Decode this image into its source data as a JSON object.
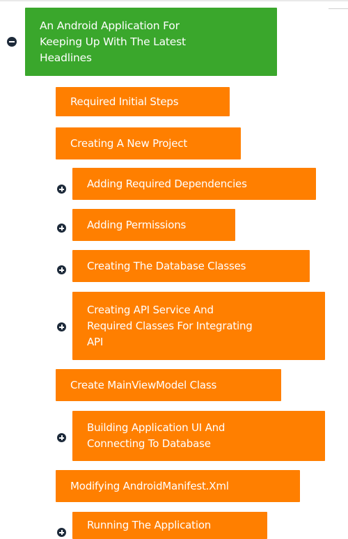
{
  "mindmap": {
    "root": {
      "label": "An Android Application For Keeping Up With The Latest Headlines",
      "lines": [
        "An Android Application For",
        "Keeping Up With The Latest",
        "Headlines"
      ],
      "expanded": true,
      "color": "#3aa72c"
    },
    "node_color": "#ff7f00",
    "toggle_color": "#1d2a3a",
    "children": [
      {
        "lines": [
          "Required Initial Steps"
        ],
        "has_children": false
      },
      {
        "lines": [
          "Creating A New Project"
        ],
        "has_children": false
      },
      {
        "lines": [
          "Adding Required Dependencies"
        ],
        "has_children": true,
        "expanded": false
      },
      {
        "lines": [
          "Adding Permissions"
        ],
        "has_children": true,
        "expanded": false
      },
      {
        "lines": [
          "Creating The Database Classes"
        ],
        "has_children": true,
        "expanded": false
      },
      {
        "lines": [
          "Creating API Service And",
          "Required Classes For Integrating",
          "API"
        ],
        "has_children": true,
        "expanded": false
      },
      {
        "lines": [
          "Create MainViewModel Class"
        ],
        "has_children": false
      },
      {
        "lines": [
          "Building Application UI And",
          "Connecting To Database"
        ],
        "has_children": true,
        "expanded": false
      },
      {
        "lines": [
          "Modifying AndroidManifest.Xml"
        ],
        "has_children": false
      },
      {
        "lines": [
          "Running The Application"
        ],
        "has_children": true,
        "expanded": false
      }
    ]
  }
}
